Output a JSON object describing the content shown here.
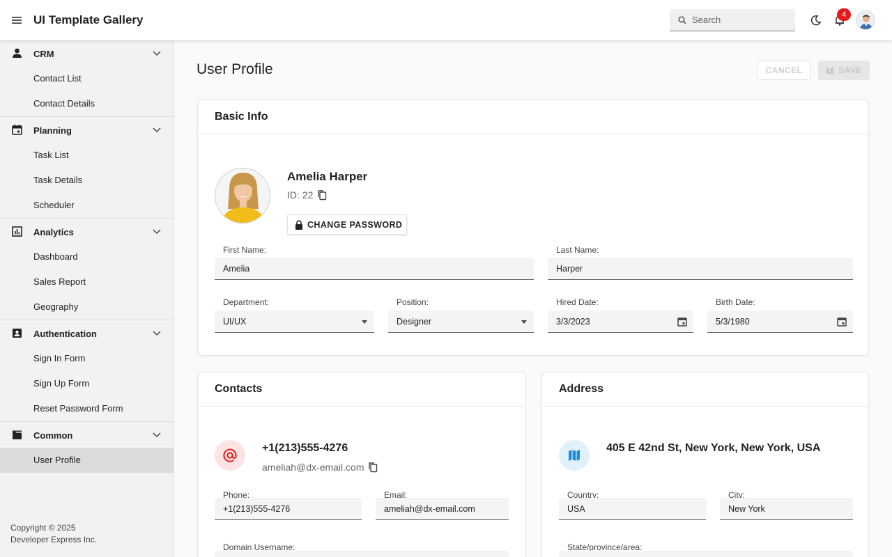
{
  "header": {
    "app_title": "UI Template Gallery",
    "search_placeholder": "Search",
    "notification_count": "4"
  },
  "sidebar": {
    "groups": [
      {
        "label": "CRM",
        "icon": "person-icon",
        "items": [
          "Contact List",
          "Contact Details"
        ]
      },
      {
        "label": "Planning",
        "icon": "calendar-icon",
        "items": [
          "Task List",
          "Task Details",
          "Scheduler"
        ]
      },
      {
        "label": "Analytics",
        "icon": "chart-icon",
        "items": [
          "Dashboard",
          "Sales Report",
          "Geography"
        ]
      },
      {
        "label": "Authentication",
        "icon": "contact-card-icon",
        "items": [
          "Sign In Form",
          "Sign Up Form",
          "Reset Password Form"
        ]
      },
      {
        "label": "Common",
        "icon": "folder-icon",
        "items": [
          "User Profile"
        ]
      }
    ],
    "active_item": "User Profile",
    "copyright_line1": "Copyright © 2025",
    "copyright_line2": "Developer Express Inc."
  },
  "page": {
    "title": "User Profile",
    "cancel_label": "CANCEL",
    "save_label": "SAVE"
  },
  "basic_info": {
    "heading": "Basic Info",
    "name": "Amelia Harper",
    "id_text": "ID: 22",
    "change_password_label": "CHANGE PASSWORD",
    "first_name_label": "First Name:",
    "first_name": "Amelia",
    "last_name_label": "Last Name:",
    "last_name": "Harper",
    "department_label": "Department:",
    "department": "UI/UX",
    "position_label": "Position:",
    "position": "Designer",
    "hired_date_label": "Hired Date:",
    "hired_date": "3/3/2023",
    "birth_date_label": "Birth Date:",
    "birth_date": "5/3/1980"
  },
  "contacts": {
    "heading": "Contacts",
    "phone_display": "+1(213)555-4276",
    "email_display": "ameliah@dx-email.com",
    "phone_label": "Phone:",
    "phone": "+1(213)555-4276",
    "email_label": "Email:",
    "email": "ameliah@dx-email.com",
    "domain_label": "Domain Username:"
  },
  "address": {
    "heading": "Address",
    "full_address": "405 E 42nd St, New York, New York, USA",
    "country_label": "Country:",
    "country": "USA",
    "city_label": "City:",
    "city": "New York",
    "state_label": "State/province/area:"
  },
  "colors": {
    "accent_red": "#e41b1b",
    "contact_icon_bg": "#fde4e4",
    "address_icon_bg": "#e0f1fb"
  }
}
